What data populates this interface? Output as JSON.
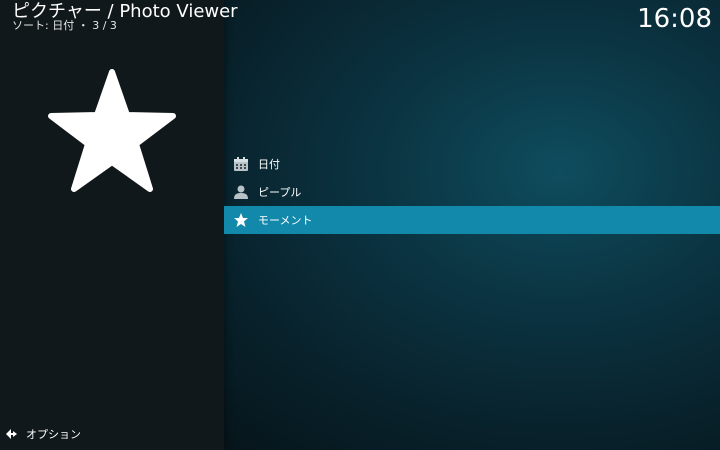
{
  "header": {
    "title": "ピクチャー / Photo Viewer",
    "subtitle": "ソート: 日付 ・ 3 / 3"
  },
  "clock": "16:08",
  "preview": {
    "icon": "star-icon"
  },
  "menu": {
    "items": [
      {
        "label": "日付",
        "icon": "calendar-icon",
        "selected": false
      },
      {
        "label": "ピープル",
        "icon": "person-icon",
        "selected": false
      },
      {
        "label": "モーメント",
        "icon": "star-icon",
        "selected": true
      }
    ]
  },
  "footer": {
    "options_label": "オプション",
    "options_icon": "options-arrows-icon"
  },
  "colors": {
    "selection": "#1288ab",
    "left_panel": "#11181b",
    "background": "#0b3442"
  }
}
